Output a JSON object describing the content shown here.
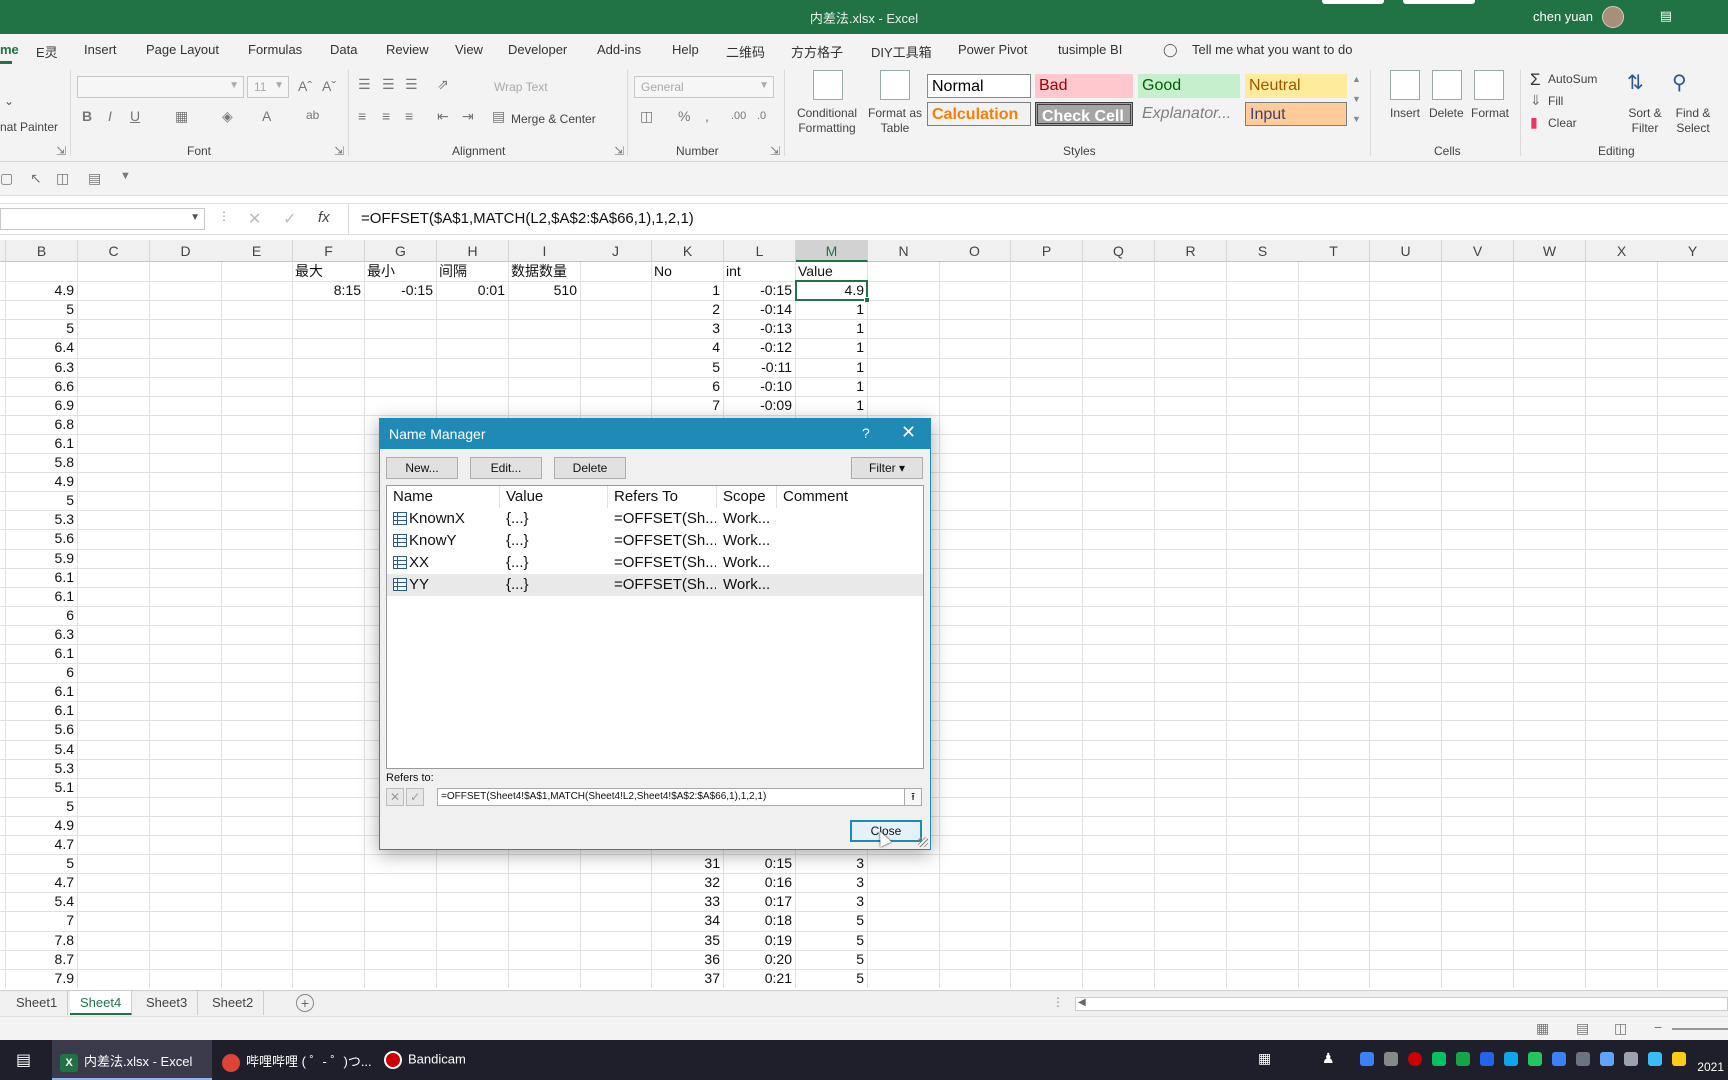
{
  "window": {
    "title": "内差法.xlsx - Excel",
    "user": "chen yuan",
    "accent": "#217346"
  },
  "tabs": [
    "me",
    "E灵",
    "Insert",
    "Page Layout",
    "Formulas",
    "Data",
    "Review",
    "View",
    "Developer",
    "Add-ins",
    "Help",
    "二维码",
    "方方格子",
    "DIY工具箱",
    "Power Pivot",
    "tusimple BI"
  ],
  "tell_me": "Tell me what you want to do",
  "ribbon": {
    "clipboard_painter": "nat Painter",
    "font_size": "11",
    "font_group": "Font",
    "wrap_text": "Wrap Text",
    "merge_center": "Merge & Center",
    "alignment_group": "Alignment",
    "number_format": "General",
    "number_group": "Number",
    "conditional_formatting": "Conditional Formatting",
    "format_as_table": "Format as Table",
    "styles": {
      "normal": "Normal",
      "bad": "Bad",
      "good": "Good",
      "neutral": "Neutral",
      "calculation": "Calculation",
      "check_cell": "Check Cell",
      "explanatory": "Explanator...",
      "input": "Input"
    },
    "styles_group": "Styles",
    "insert": "Insert",
    "delete": "Delete",
    "format": "Format",
    "cells_group": "Cells",
    "autosum": "AutoSum",
    "fill": "Fill",
    "clear": "Clear",
    "sort_filter": "Sort & Filter",
    "find_select": "Find & Select",
    "editing_group": "Editing"
  },
  "formula_bar": {
    "formula": "=OFFSET($A$1,MATCH(L2,$A$2:$A$66,1),1,2,1)"
  },
  "grid": {
    "columns": [
      "B",
      "C",
      "D",
      "E",
      "F",
      "G",
      "H",
      "I",
      "J",
      "K",
      "L",
      "M",
      "N",
      "O",
      "P",
      "Q",
      "R",
      "S",
      "T",
      "U",
      "V",
      "W",
      "X",
      "Y"
    ],
    "selected_column": "M",
    "col_b_values": [
      "4.9",
      "5",
      "5",
      "6.4",
      "6.3",
      "6.6",
      "6.9",
      "6.8",
      "6.1",
      "5.8",
      "4.9",
      "5",
      "5.3",
      "5.6",
      "5.9",
      "6.1",
      "6.1",
      "6",
      "6.3",
      "6.1",
      "6",
      "6.1",
      "6.1",
      "5.6",
      "5.4",
      "5.3",
      "5.1",
      "5",
      "4.9",
      "4.7",
      "5",
      "4.7",
      "5.4",
      "7",
      "7.8",
      "8.7",
      "7.9"
    ],
    "header_row": {
      "F": "最大",
      "G": "最小",
      "H": "间隔",
      "I": "数据数量",
      "K": "No",
      "L": "int",
      "M": "Value"
    },
    "row2": {
      "F": "8:15",
      "G": "-0:15",
      "H": "0:01",
      "I": "510"
    },
    "klm_top": [
      {
        "no": "1",
        "int": "-0:15",
        "value": "4.9"
      },
      {
        "no": "2",
        "int": "-0:14",
        "value": "1"
      },
      {
        "no": "3",
        "int": "-0:13",
        "value": "1"
      },
      {
        "no": "4",
        "int": "-0:12",
        "value": "1"
      },
      {
        "no": "5",
        "int": "-0:11",
        "value": "1"
      },
      {
        "no": "6",
        "int": "-0:10",
        "value": "1"
      },
      {
        "no": "7",
        "int": "-0:09",
        "value": "1"
      }
    ],
    "klm_bottom": [
      {
        "no": "31",
        "int": "0:15",
        "value": "3"
      },
      {
        "no": "32",
        "int": "0:16",
        "value": "3"
      },
      {
        "no": "33",
        "int": "0:17",
        "value": "3"
      },
      {
        "no": "34",
        "int": "0:18",
        "value": "5"
      },
      {
        "no": "35",
        "int": "0:19",
        "value": "5"
      },
      {
        "no": "36",
        "int": "0:20",
        "value": "5"
      },
      {
        "no": "37",
        "int": "0:21",
        "value": "5"
      }
    ]
  },
  "sheets": [
    "Sheet1",
    "Sheet4",
    "Sheet3",
    "Sheet2"
  ],
  "active_sheet": "Sheet4",
  "dialog": {
    "title": "Name Manager",
    "help": "?",
    "buttons": {
      "new": "New...",
      "edit": "Edit...",
      "delete": "Delete",
      "filter": "Filter ▾"
    },
    "columns": [
      "Name",
      "Value",
      "Refers To",
      "Scope",
      "Comment"
    ],
    "rows": [
      {
        "name": "KnownX",
        "value": "{...}",
        "refers": "=OFFSET(Sh...",
        "scope": "Work...",
        "comment": ""
      },
      {
        "name": "KnowY",
        "value": "{...}",
        "refers": "=OFFSET(Sh...",
        "scope": "Work...",
        "comment": ""
      },
      {
        "name": "XX",
        "value": "{...}",
        "refers": "=OFFSET(Sh...",
        "scope": "Work...",
        "comment": ""
      },
      {
        "name": "YY",
        "value": "{...}",
        "refers": "=OFFSET(Sh...",
        "scope": "Work...",
        "comment": ""
      }
    ],
    "selected_row": 3,
    "refers_to_label": "Refers to:",
    "refers_to_value": "=OFFSET(Sheet4!$A$1,MATCH(Sheet4!L2,Sheet4!$A$2:$A$66,1),1,2,1)",
    "close": "Close"
  },
  "taskbar": {
    "items": [
      "内差法.xlsx - Excel",
      "哔哩哔哩 ( ゜- ゜)つ...",
      "Bandicam"
    ],
    "year": "2021"
  }
}
